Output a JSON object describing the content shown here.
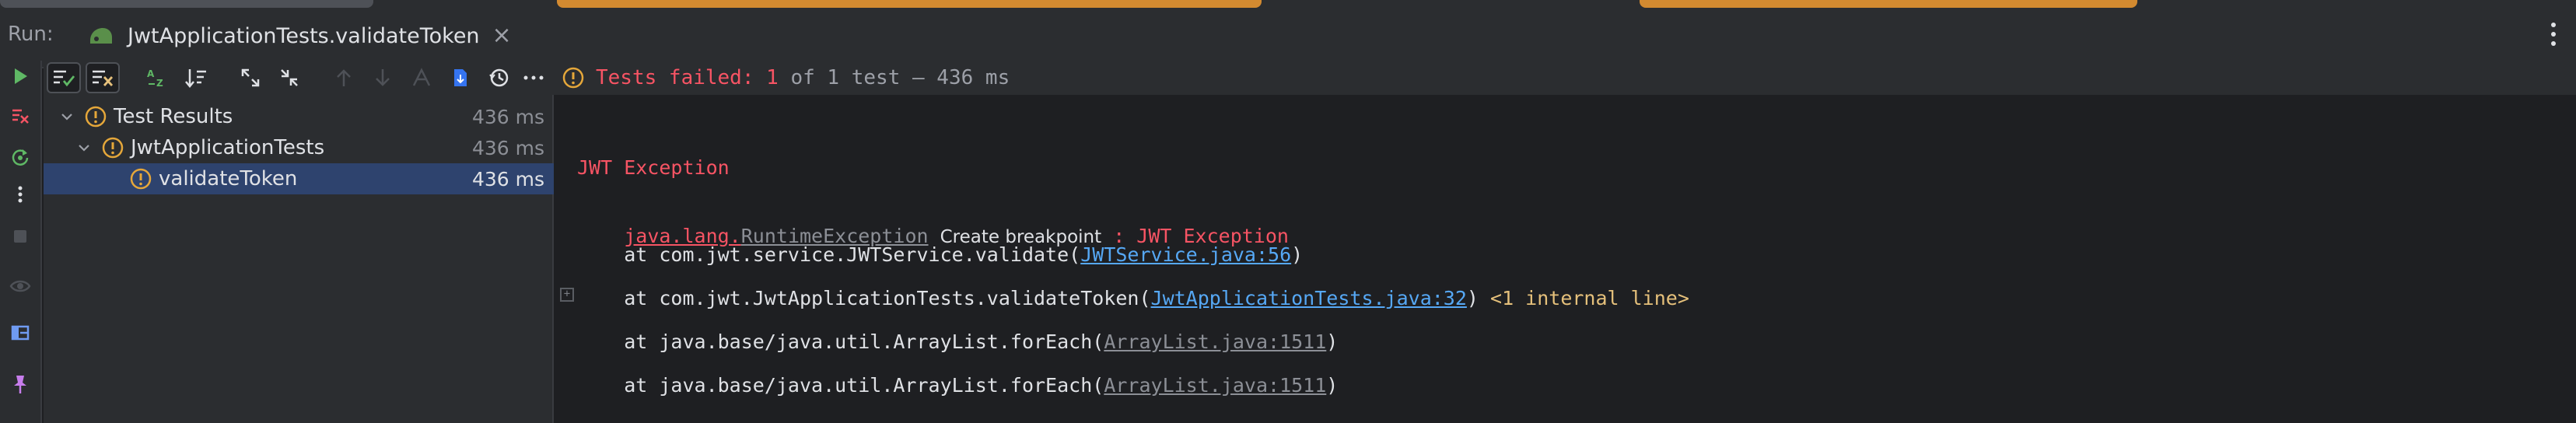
{
  "run_bar": {
    "label": "Run:",
    "tab_title": "JwtApplicationTests.validateToken",
    "close_glyph": "×",
    "accent_color": "#d38a30",
    "tab_underline_color": "#3574f0"
  },
  "status": {
    "failed_text": "Tests failed: 1",
    "summary_text": " of 1 test – 436 ms",
    "failed_color": "#f75464"
  },
  "tree": {
    "rows": [
      {
        "label": "Test Results",
        "time": "436 ms",
        "expanded": true,
        "selected": false
      },
      {
        "label": "JwtApplicationTests",
        "time": "436 ms",
        "expanded": true,
        "selected": false
      },
      {
        "label": "validateToken",
        "time": "436 ms",
        "expanded": false,
        "selected": true
      }
    ]
  },
  "console": {
    "header": "JWT Exception",
    "exception_class": "java.lang.RuntimeException",
    "create_breakpoint": "Create breakpoint",
    "exception_suffix": " : JWT Exception",
    "frames": [
      {
        "prefix": "    at com.jwt.service.JWTService.validate(",
        "link": "JWTService.java:56",
        "suffix": ")",
        "note": ""
      },
      {
        "prefix": "    at com.jwt.JwtApplicationTests.validateToken(",
        "link": "JwtApplicationTests.java:32",
        "suffix": ")",
        "note": " <1 internal line>"
      },
      {
        "prefix": "    at java.base/java.util.ArrayList.forEach(",
        "link": "ArrayList.java:1511",
        "suffix": ")",
        "note": ""
      },
      {
        "prefix": "    at java.base/java.util.ArrayList.forEach(",
        "link": "ArrayList.java:1511",
        "suffix": ")",
        "note": ""
      }
    ]
  },
  "icons": {
    "left_toolbar": [
      "run-icon",
      "stop-rerun-failed-icon",
      "rerun-icon",
      "more-vertical-icon",
      "stop-icon",
      "eye-icon",
      "layout-icon",
      "pin-icon"
    ],
    "test_toolbar": [
      "show-passed-icon",
      "show-ignored-icon",
      "sort-alpha-icon",
      "sort-duration-icon",
      "expand-all-icon",
      "collapse-all-icon",
      "previous-failed-icon",
      "next-failed-icon",
      "coverage-icon",
      "export-icon",
      "history-icon",
      "more-horizontal-icon"
    ]
  }
}
